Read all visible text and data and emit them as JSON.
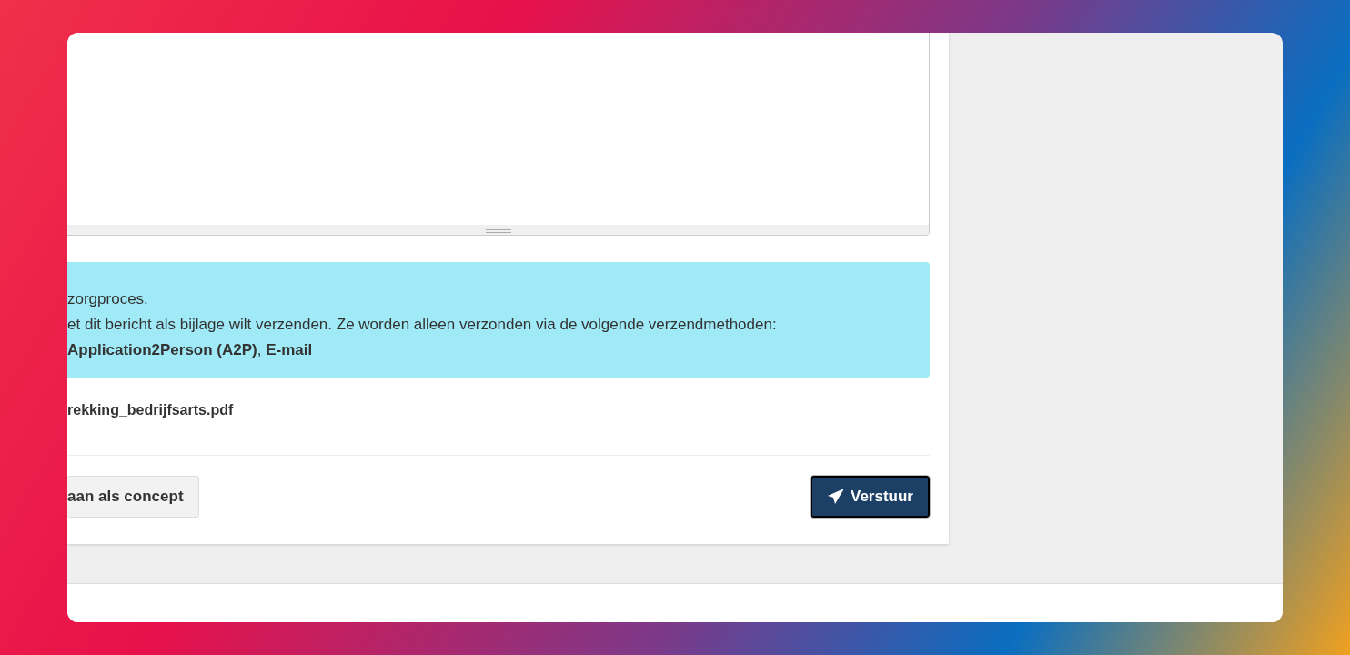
{
  "message_field": {
    "resizable": true
  },
  "info_alert": {
    "lines": [
      "zorgproces.",
      "et dit bericht als bijlage wilt verzenden. Ze worden alleen verzonden via de volgende verzendmethoden:",
      "**Application2Person (A2P)**, **E-mail**"
    ]
  },
  "attachment": {
    "file_name": "rekking_bedrijfsarts.pdf"
  },
  "footer_buttons": [
    {
      "label": "aan als concept",
      "kind": "secondary"
    },
    {
      "label": "Verstuur",
      "kind": "primary"
    }
  ]
}
